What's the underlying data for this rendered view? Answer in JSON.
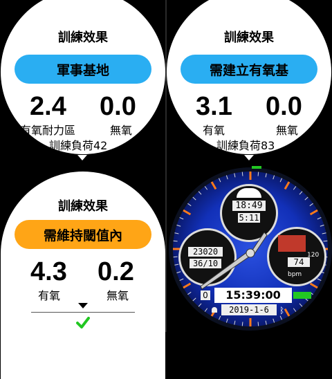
{
  "panel1": {
    "title": "訓練效果",
    "pill": "軍事基地",
    "aerobic_value": "2.4",
    "aerobic_label": "有氧耐力區",
    "anaerobic_value": "0.0",
    "anaerobic_label": "無氧",
    "load": "訓練負荷42"
  },
  "panel2": {
    "title": "訓練效果",
    "pill": "需建立有氧基",
    "aerobic_value": "3.1",
    "aerobic_label": "有氧",
    "anaerobic_value": "0.0",
    "anaerobic_label": "無氧",
    "load": "訓練負荷83"
  },
  "panel3": {
    "title": "訓練效果",
    "pill": "需維持閾值內",
    "aerobic_value": "4.3",
    "aerobic_label": "有氧",
    "anaerobic_value": "0.2",
    "anaerobic_label": "無氧"
  },
  "colors": {
    "pill_blue": "#2aaef2",
    "pill_orange": "#ffa516",
    "check_green": "#22c722",
    "face_blue": "#1230b8"
  },
  "watch": {
    "time_small": "18:49",
    "seconds_small": "5:11",
    "steps": "23020",
    "date_small": "36/10",
    "hr_value": "74",
    "hr_max": "120",
    "hr_unit": "bpm",
    "time_main": "15:39:00",
    "notif_count": "0",
    "date_main": "2019-1-6"
  },
  "icons": [
    "chevron-down-icon",
    "check-icon",
    "sun-icon",
    "bluetooth-icon",
    "bell-icon"
  ]
}
